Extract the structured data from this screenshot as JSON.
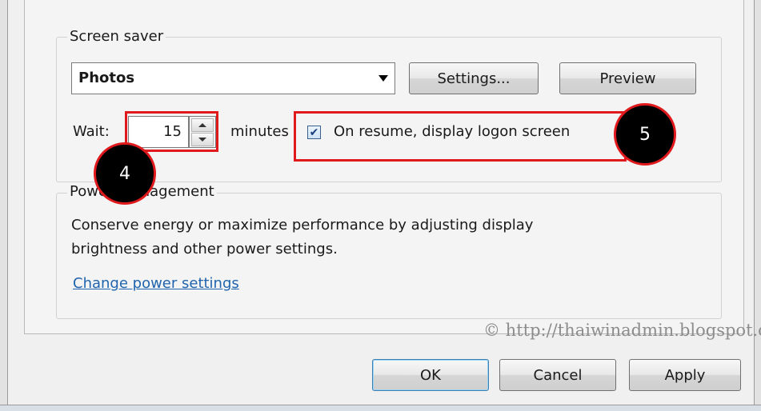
{
  "screen_saver": {
    "legend": "Screen saver",
    "selected": "Photos",
    "settings_label": "Settings...",
    "preview_label": "Preview",
    "wait_label": "Wait:",
    "wait_value": "15",
    "minutes_label": "minutes",
    "resume_checked": true,
    "resume_label": "On resume, display logon screen"
  },
  "power": {
    "legend": "Power management",
    "description_line1": "Conserve energy or maximize performance by adjusting display",
    "description_line2": "brightness and other power settings.",
    "link": "Change power settings"
  },
  "callouts": {
    "four": "4",
    "five": "5"
  },
  "watermark": "© http://thaiwinadmin.blogspot.com",
  "buttons": {
    "ok": "OK",
    "cancel": "Cancel",
    "apply": "Apply"
  },
  "colors": {
    "highlight": "#e0191c",
    "link": "#1f64ad",
    "callout_fill": "#000000"
  }
}
